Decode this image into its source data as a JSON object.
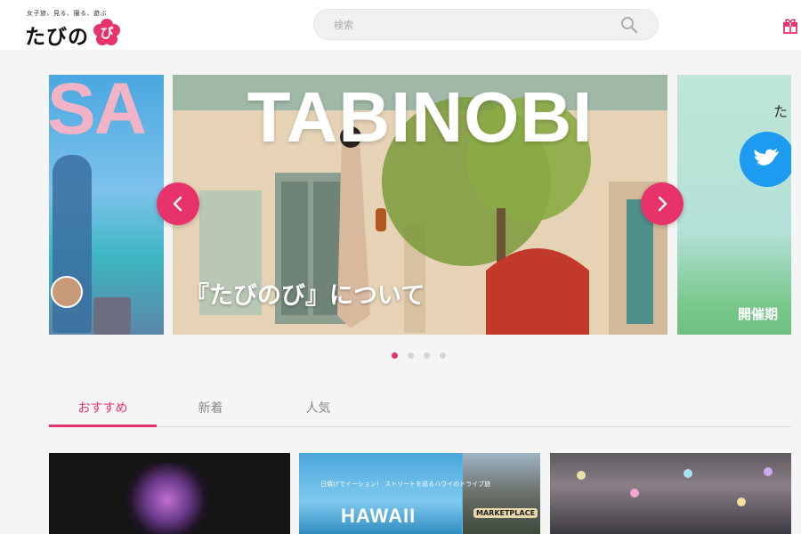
{
  "header": {
    "logo_tagline": "女子旅、見る、撮る、遊ぶ",
    "logo_text": "たびの",
    "logo_mark": "び",
    "search_placeholder": "検索",
    "brand_color": "#e8336a"
  },
  "carousel": {
    "main_title": "TABINOBI",
    "main_caption": "『たびのび』について",
    "left_slide_text": "SA",
    "right_slide_text": "開催期",
    "right_slide_partial": "た",
    "active_index": 0,
    "dot_count": 4
  },
  "tabs": [
    {
      "label": "おすすめ",
      "active": true
    },
    {
      "label": "新着",
      "active": false
    },
    {
      "label": "人気",
      "active": false
    }
  ],
  "cards": [
    {
      "image": "fireworks-night"
    },
    {
      "image": "hawaii-drive",
      "overlay_title": "HAWAII",
      "overlay_sub": "日焼けでイーション！ ストリートを巡るハワイのドライブ旅",
      "side_sign": "MARKETPLACE"
    },
    {
      "image": "illuminated-garden"
    }
  ]
}
